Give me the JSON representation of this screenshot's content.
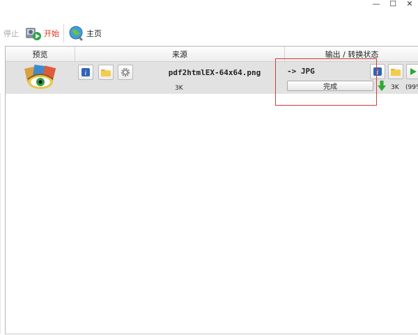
{
  "window_controls": {
    "minimize": "—",
    "maximize": "☐",
    "close": "✕"
  },
  "toolbar": {
    "stop_label": "停止",
    "start_label": "开始",
    "home_label": "主页"
  },
  "table": {
    "headers": {
      "preview": "预览",
      "source": "来源",
      "output": "输出 / 转换状态"
    },
    "rows": [
      {
        "filename": "pdf2htmlEX-64x64.png",
        "source_size": "3K",
        "output_format": "-> JPG",
        "status": "完成",
        "output_size": "3K",
        "output_percent": "(99%"
      }
    ]
  },
  "colors": {
    "accent_red": "#e0331a",
    "highlight_box": "#d23a3a",
    "progress_green": "#2da832"
  }
}
